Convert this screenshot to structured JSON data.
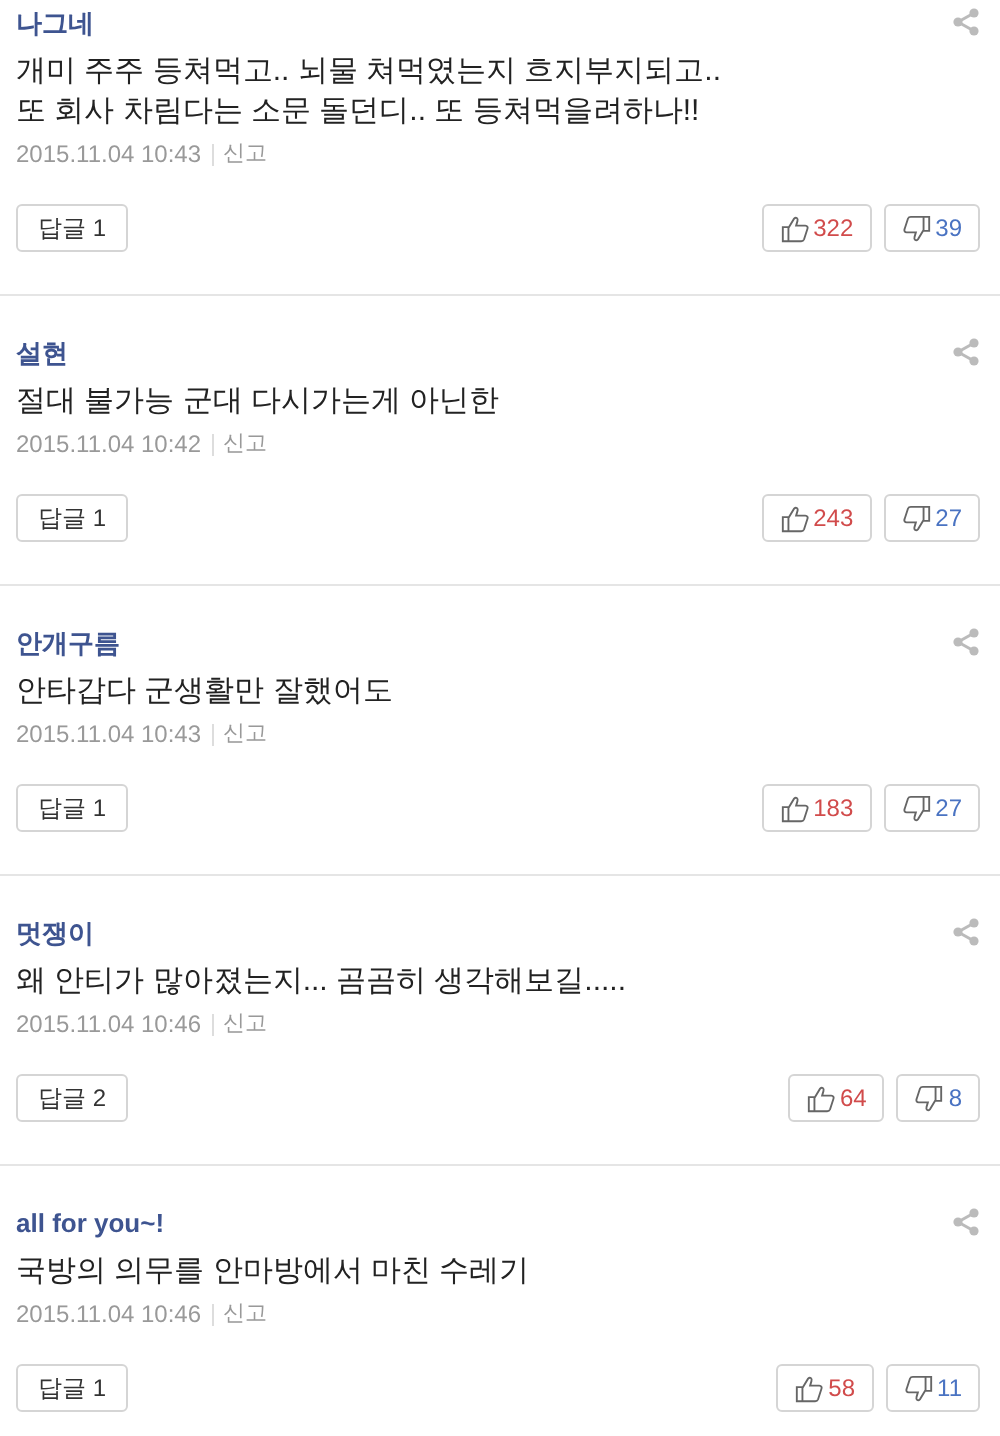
{
  "comments": [
    {
      "author": "나그네",
      "body": "개미 주주 등쳐먹고.. 뇌물 쳐먹였는지 흐지부지되고..\n또 회사 차림다는 소문 돌던디.. 또 등쳐먹을려하나!!",
      "date": "2015.11.04 10:43",
      "report": "신고",
      "reply": "답글 1",
      "likes": "322",
      "dislikes": "39"
    },
    {
      "author": "설현",
      "body": "절대 불가능 군대 다시가는게 아닌한",
      "date": "2015.11.04 10:42",
      "report": "신고",
      "reply": "답글 1",
      "likes": "243",
      "dislikes": "27"
    },
    {
      "author": "안개구름",
      "body": "안타갑다 군생활만 잘했어도",
      "date": "2015.11.04 10:43",
      "report": "신고",
      "reply": "답글 1",
      "likes": "183",
      "dislikes": "27"
    },
    {
      "author": "멋쟁이",
      "body": "왜 안티가 많아졌는지... 곰곰히 생각해보길.....",
      "date": "2015.11.04 10:46",
      "report": "신고",
      "reply": "답글 2",
      "likes": "64",
      "dislikes": "8"
    },
    {
      "author": "all for you~!",
      "body": "국방의 의무를 안마방에서 마친 수레기",
      "date": "2015.11.04 10:46",
      "report": "신고",
      "reply": "답글 1",
      "likes": "58",
      "dislikes": "11"
    }
  ]
}
